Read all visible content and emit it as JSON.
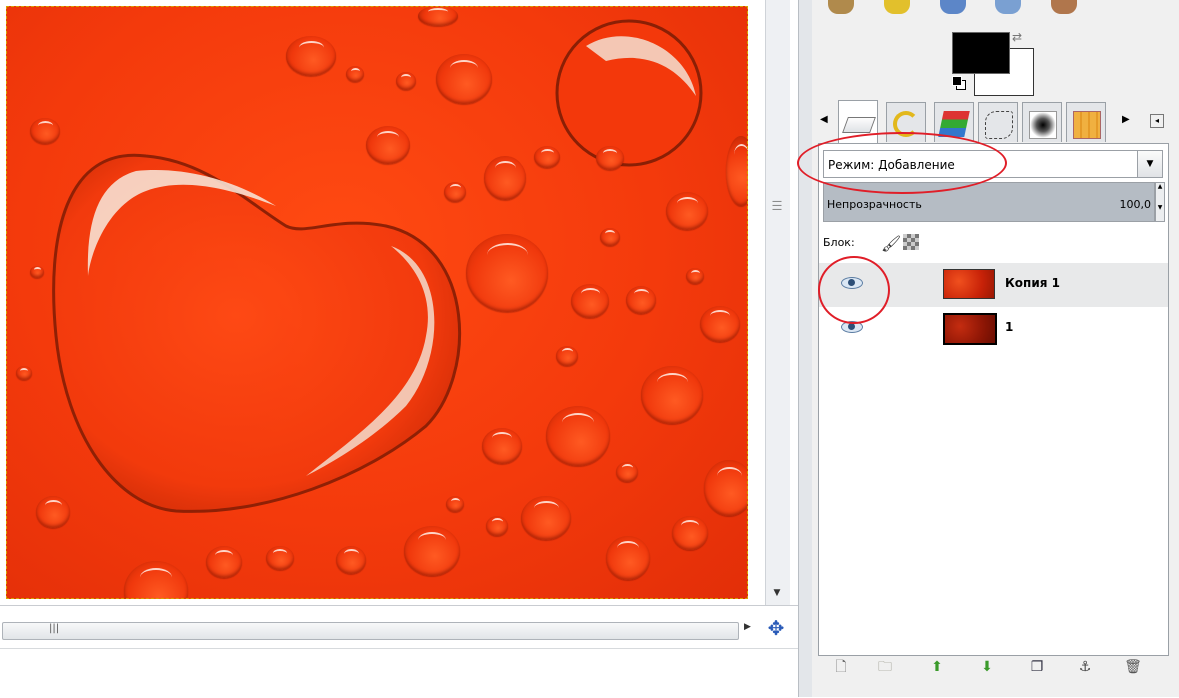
{
  "layers_panel": {
    "mode": {
      "label": "Режим: Добавление"
    },
    "opacity": {
      "label": "Непрозрачность",
      "value": "100,0"
    },
    "lock": {
      "label": "Блок:"
    },
    "layers": [
      {
        "name": "Копия 1",
        "visible": true,
        "selected": true
      },
      {
        "name": "1",
        "visible": true,
        "selected": false
      }
    ]
  },
  "colors": {
    "foreground": "#000000",
    "background": "#ffffff",
    "annotation": "#e01e28",
    "image_main": "#f43a0c"
  },
  "dock_tabs": [
    {
      "icon": "layers-tab-icon",
      "active": true
    },
    {
      "icon": "undo-history-tab-icon",
      "active": false
    },
    {
      "icon": "channels-tab-icon",
      "active": false
    },
    {
      "icon": "paths-tab-icon",
      "active": false
    },
    {
      "icon": "brushes-tab-icon",
      "active": false
    },
    {
      "icon": "patterns-tab-icon",
      "active": false
    }
  ],
  "layer_actions": [
    "new-layer-icon",
    "new-layer-group-icon",
    "raise-layer-icon",
    "lower-layer-icon",
    "duplicate-layer-icon",
    "anchor-layer-icon",
    "delete-layer-icon"
  ]
}
